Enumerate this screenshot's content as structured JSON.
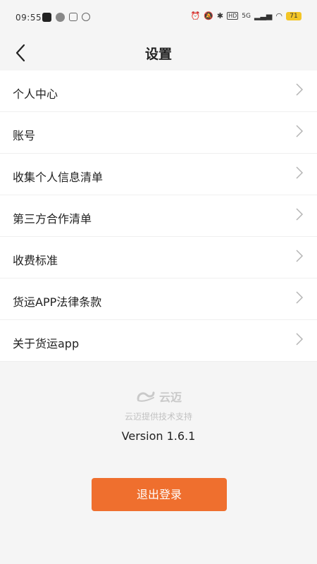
{
  "status_bar": {
    "time": "09:55",
    "network": "5G",
    "battery": "71",
    "icons": [
      "app-icon",
      "message-icon",
      "instagram-icon",
      "link-icon",
      "alarm-icon",
      "mute-icon",
      "bluetooth-icon",
      "hd-icon",
      "signal-icon",
      "wifi-icon",
      "battery-icon"
    ]
  },
  "header": {
    "title": "设置"
  },
  "menu": {
    "items": [
      {
        "label": "个人中心"
      },
      {
        "label": "账号"
      },
      {
        "label": "收集个人信息清单"
      },
      {
        "label": "第三方合作清单"
      },
      {
        "label": "收费标准"
      },
      {
        "label": "货运APP法律条款"
      },
      {
        "label": "关于货运app"
      }
    ]
  },
  "footer": {
    "brand": "云迈",
    "support_text": "云迈提供技术支持",
    "version": "Version 1.6.1"
  },
  "logout": {
    "label": "退出登录",
    "color": "#ef6f2e"
  }
}
